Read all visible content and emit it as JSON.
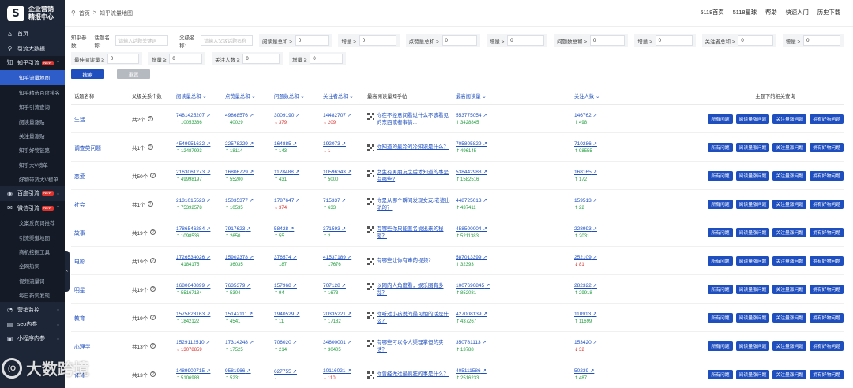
{
  "sidebar": {
    "logo_line1": "企业营销",
    "logo_line2": "精报中心",
    "items": [
      {
        "label": "首页",
        "type": "top",
        "icon": "home-icon"
      },
      {
        "label": "引流大数据",
        "type": "top",
        "icon": "funnel-icon",
        "chevron": "up"
      },
      {
        "label": "知乎引流",
        "type": "parent",
        "icon": "zhihu-icon",
        "badge": "NEW",
        "chevron": "up"
      },
      {
        "label": "知乎流量地图",
        "type": "sub-active"
      },
      {
        "label": "知乎精选百度排名",
        "type": "sub"
      },
      {
        "label": "知乎引流查询",
        "type": "sub"
      },
      {
        "label": "阅读量涨贴",
        "type": "sub"
      },
      {
        "label": "关注量涨贴",
        "type": "sub"
      },
      {
        "label": "知乎好物链路",
        "type": "sub"
      },
      {
        "label": "知乎大V榜单",
        "type": "sub"
      },
      {
        "label": "好物带货大V榜单",
        "type": "sub"
      },
      {
        "label": "百度引流",
        "type": "top",
        "icon": "baidu-icon",
        "badge": "NEW",
        "chevron": "down"
      },
      {
        "label": "微信引流",
        "type": "parent",
        "icon": "wechat-icon",
        "badge": "NEW",
        "chevron": "up"
      },
      {
        "label": "文案反向词推荐",
        "type": "sub2"
      },
      {
        "label": "引流渠道地图",
        "type": "sub2"
      },
      {
        "label": "商机挖掘工具",
        "type": "sub2"
      },
      {
        "label": "全网热词",
        "type": "sub2"
      },
      {
        "label": "视频流量词",
        "type": "sub2"
      },
      {
        "label": "每日新词发现",
        "type": "sub2"
      },
      {
        "label": "营销监控",
        "type": "top",
        "icon": "monitor-icon",
        "chevron": "down"
      },
      {
        "label": "seo内参",
        "type": "top",
        "icon": "book-icon",
        "chevron": "down"
      },
      {
        "label": "小程序内参",
        "type": "top",
        "icon": "app-icon",
        "chevron": "down"
      }
    ]
  },
  "breadcrumb": {
    "home": "首页",
    "sep": ">",
    "current": "知乎流量地图"
  },
  "top_links": [
    "5118首页",
    "5118星球",
    "帮助",
    "快速入门",
    "历史下载"
  ],
  "filters": {
    "keyword_label": "知乎参数",
    "topic_label": "话题名称:",
    "topic_placeholder": "请输入话题关键词",
    "parent_label": "父级名称:",
    "parent_placeholder": "请输入父级话题名称",
    "row1": [
      {
        "label": "阅读量总和 ≥",
        "value": "0"
      },
      {
        "label": "增量 ≥",
        "value": "0"
      },
      {
        "label": "点赞量总和 ≥",
        "value": "0"
      },
      {
        "label": "增量 ≥",
        "value": "0"
      },
      {
        "label": "问题数总和 ≥",
        "value": "0"
      },
      {
        "label": "增量 ≥",
        "value": "0"
      },
      {
        "label": "关注者总和 ≥",
        "value": "0"
      },
      {
        "label": "增量 ≥",
        "value": "0"
      }
    ],
    "row2": [
      {
        "label": "最佳阅读量 ≥",
        "value": "0"
      },
      {
        "label": "增量 ≥",
        "value": "0"
      },
      {
        "label": "关注人数 ≥",
        "value": "0"
      },
      {
        "label": "增量 ≥",
        "value": "0"
      }
    ],
    "search_btn": "搜索",
    "reset_btn": "重置"
  },
  "table": {
    "headers": [
      "话题名称",
      "父级关系个数",
      "阅读量总和",
      "点赞量总和",
      "问题数总和",
      "关注者总和",
      "最高阅读量知乎帖",
      "最高阅读量",
      "关注人数",
      "主题下的相关查询"
    ],
    "action_labels": [
      "所有问题",
      "阅读量涨问题",
      "关注量涨问题",
      "拥有好物问题"
    ],
    "rows": [
      {
        "topic": "生活",
        "count": "共2个",
        "read": "7481425207",
        "read_d": "10053386",
        "read_dir": "up",
        "like": "49868576",
        "like_d": "40029",
        "like_dir": "up",
        "q": "3009190",
        "q_d": "379",
        "q_dir": "down",
        "fol": "14482707",
        "fol_d": "209",
        "fol_dir": "down",
        "title": "你在不经意间看过什么不该看见的东西或者事情...",
        "best": "553775054",
        "best_d": "3428845",
        "best_dir": "up",
        "fans": "146762",
        "fans_d": "498",
        "fans_dir": "up"
      },
      {
        "topic": "调查类问题",
        "count": "共1个",
        "read": "4549951632",
        "read_d": "12487993",
        "read_dir": "up",
        "like": "22578229",
        "like_d": "18114",
        "like_dir": "up",
        "q": "164885",
        "q_d": "143",
        "q_dir": "up",
        "fol": "192073",
        "fol_d": "1",
        "fol_dir": "down",
        "title": "你知道的最冷的冷知识是什么？",
        "best": "705805829",
        "best_d": "496145",
        "best_dir": "up",
        "fans": "710286",
        "fans_d": "98555",
        "fans_dir": "up"
      },
      {
        "topic": "恋爱",
        "count": "共50个",
        "read": "2163061273",
        "read_d": "49998197",
        "read_dir": "up",
        "like": "16806729",
        "like_d": "55200",
        "like_dir": "up",
        "q": "1128488",
        "q_d": "431",
        "q_dir": "up",
        "fol": "10596343",
        "fol_d": "5000",
        "fol_dir": "up",
        "title": "女生有男朋友之后才知道的事是有哪些?",
        "best": "538442988",
        "best_d": "1582516",
        "best_dir": "up",
        "fans": "168165",
        "fans_d": "172",
        "fans_dir": "up"
      },
      {
        "topic": "社会",
        "count": "共1个",
        "read": "2131015523",
        "read_d": "75392578",
        "read_dir": "up",
        "like": "15035377",
        "like_d": "10535",
        "like_dir": "up",
        "q": "1787647",
        "q_d": "374",
        "q_dir": "down",
        "fol": "715337",
        "fol_d": "633",
        "fol_dir": "up",
        "title": "你是从哪个瞬间发现女友/老婆出轨的？",
        "best": "448725013",
        "best_d": "437411",
        "best_dir": "up",
        "fans": "159513",
        "fans_d": "22",
        "fans_dir": "up"
      },
      {
        "topic": "故事",
        "count": "共19个",
        "read": "1786546284",
        "read_d": "1098536",
        "read_dir": "up",
        "like": "7917623",
        "like_d": "2650",
        "like_dir": "up",
        "q": "58428",
        "q_d": "55",
        "q_dir": "up",
        "fol": "371593",
        "fol_d": "2",
        "fol_dir": "up",
        "title": "有哪些你只能匿名说出来的秘密？",
        "best": "458500004",
        "best_d": "5211383",
        "best_dir": "up",
        "fans": "228993",
        "fans_d": "2031",
        "fans_dir": "up"
      },
      {
        "topic": "电影",
        "count": "共19个",
        "read": "1726534026",
        "read_d": "4184175",
        "read_dir": "up",
        "like": "15902378",
        "like_d": "36035",
        "like_dir": "up",
        "q": "376574",
        "q_d": "187",
        "q_dir": "up",
        "fol": "41537189",
        "fol_d": "17676",
        "fol_dir": "up",
        "title": "有哪些让你有毒的视频?",
        "best": "587013399",
        "best_d": "32393",
        "best_dir": "up",
        "fans": "252109",
        "fans_d": "81",
        "fans_dir": "down"
      },
      {
        "topic": "明星",
        "count": "共19个",
        "read": "1680640899",
        "read_d": "55167134",
        "read_dir": "up",
        "like": "7635379",
        "like_d": "5304",
        "like_dir": "up",
        "q": "157968",
        "q_d": "94",
        "q_dir": "up",
        "fol": "707128",
        "fol_d": "1673",
        "fol_dir": "up",
        "title": "以网内人角度看，娱乐圈有多乱？",
        "best": "1007690845",
        "best_d": "852081",
        "best_dir": "up",
        "fans": "282322",
        "fans_d": "29918",
        "fans_dir": "up"
      },
      {
        "topic": "教育",
        "count": "共19个",
        "read": "1575823163",
        "read_d": "1842122",
        "read_dir": "up",
        "like": "15142111",
        "like_d": "4541",
        "like_dir": "up",
        "q": "1940529",
        "q_d": "11",
        "q_dir": "up",
        "fol": "20335221",
        "fol_d": "17182",
        "fol_dir": "up",
        "title": "你听过小孩说的最可怕的话是什么？",
        "best": "427008139",
        "best_d": "437267",
        "best_dir": "up",
        "fans": "110913",
        "fans_d": "11699",
        "fans_dir": "up"
      },
      {
        "topic": "心理学",
        "count": "共13个",
        "read": "1529112510",
        "read_d": "13078859",
        "read_dir": "down",
        "like": "17314248",
        "like_d": "17525",
        "like_dir": "up",
        "q": "706020",
        "q_d": "214",
        "q_dir": "up",
        "fol": "34600001",
        "fol_d": "30405",
        "fol_dir": "up",
        "title": "有哪些可以令人渠理掌但的实话？",
        "best": "350781113",
        "best_d": "13788",
        "best_dir": "up",
        "fans": "153420",
        "fans_d": "32",
        "fans_dir": "down"
      },
      {
        "topic": "体育",
        "count": "共13个",
        "read": "1489900715",
        "read_d": "5106988",
        "read_dir": "up",
        "like": "9581966",
        "like_d": "5231",
        "like_dir": "up",
        "q": "627755",
        "q_d": "-",
        "q_dir": "flat",
        "fol": "10116021",
        "fol_d": "110",
        "fol_dir": "down",
        "title": "你曾经做过最疯狂的事是什么？",
        "best": "405111586",
        "best_d": "2516233",
        "best_dir": "up",
        "fans": "50239",
        "fans_d": "487",
        "fans_dir": "up"
      }
    ]
  },
  "watermark": "大数跨境",
  "colors": {
    "sidebar": "#1d2636",
    "accent": "#1f4fbf",
    "up": "#1e9c3c",
    "down": "#d9302a"
  }
}
